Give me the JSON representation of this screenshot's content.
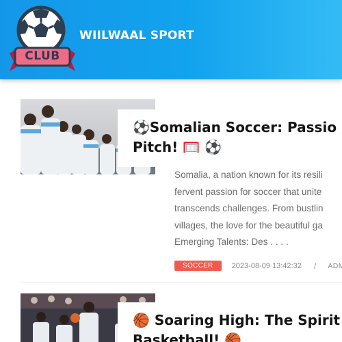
{
  "header": {
    "logo_text": "CLUB",
    "site_title": "WIILWAAL SPORT",
    "background_color": "#1497e8"
  },
  "posts": [
    {
      "image_icon": "photo-soccer-team-huddle",
      "title_line1": "⚽Somalian Soccer: Passio",
      "title_line2": "Pitch! 🥅 ⚽",
      "excerpt": "Somalia, a nation known for its resili\nfervent passion for soccer that unite\ntranscends challenges. From bustlin\nvillages, the love for the beautiful ga\nEmerging Talents: Des . . . .",
      "category": "SOCCER",
      "category_color": "#f35a4d",
      "date": "2023-08-09 13:42:32",
      "separator": "/",
      "author": "ADMIN"
    },
    {
      "image_icon": "photo-basketball-players",
      "title_line1": "🏀 Soaring High: The Spirit o",
      "title_line2": "Basketball! 🏀"
    }
  ]
}
